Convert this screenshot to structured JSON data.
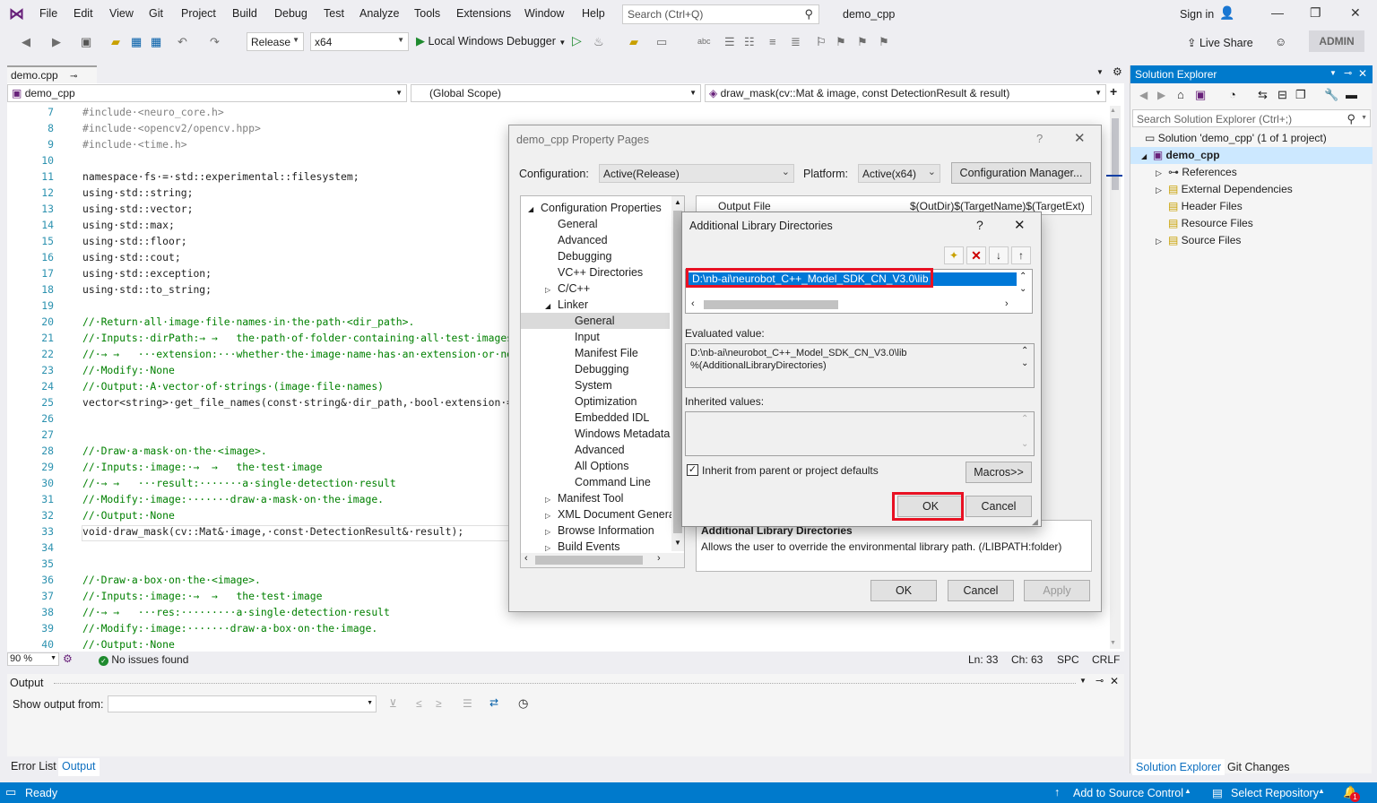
{
  "menu": {
    "items": [
      "File",
      "Edit",
      "View",
      "Git",
      "Project",
      "Build",
      "Debug",
      "Test",
      "Analyze",
      "Tools",
      "Extensions",
      "Window",
      "Help"
    ],
    "search_placeholder": "Search (Ctrl+Q)",
    "window_title": "demo_cpp",
    "sign_in": "Sign in"
  },
  "toolbar": {
    "configuration": "Release",
    "platform": "x64",
    "debugger": "Local Windows Debugger",
    "live_share": "Live Share",
    "admin": "ADMIN"
  },
  "editor": {
    "tab": "demo.cpp",
    "nav_file": "demo_cpp",
    "nav_scope": "(Global Scope)",
    "nav_member": "draw_mask(cv::Mat & image, const DetectionResult & result)",
    "zoom": "90 %",
    "issues": "No issues found",
    "ln": "Ln: 33",
    "ch": "Ch: 63",
    "spc": "SPC",
    "crlf": "CRLF"
  },
  "code": [
    {
      "n": "7",
      "t": "#include·<neuro_core.h>"
    },
    {
      "n": "8",
      "t": "#include·<opencv2/opencv.hpp>"
    },
    {
      "n": "9",
      "t": "#include·<time.h>"
    },
    {
      "n": "10",
      "t": ""
    },
    {
      "n": "11",
      "t": "namespace·fs·=·std::experimental::filesystem;"
    },
    {
      "n": "12",
      "t": "using·std::string;"
    },
    {
      "n": "13",
      "t": "using·std::vector;"
    },
    {
      "n": "14",
      "t": "using·std::max;"
    },
    {
      "n": "15",
      "t": "using·std::floor;"
    },
    {
      "n": "16",
      "t": "using·std::cout;"
    },
    {
      "n": "17",
      "t": "using·std::exception;"
    },
    {
      "n": "18",
      "t": "using·std::to_string;"
    },
    {
      "n": "19",
      "t": ""
    },
    {
      "n": "20",
      "t": "//·Return·all·image·file·names·in·the·path·<dir_path>."
    },
    {
      "n": "21",
      "t": "//·Inputs:·dirPath:→ →   the·path·of·folder·containing·all·test·images"
    },
    {
      "n": "22",
      "t": "//·→ →   ···extension:···whether·the·image·name·has·an·extension·or·not"
    },
    {
      "n": "23",
      "t": "//·Modify:·None"
    },
    {
      "n": "24",
      "t": "//·Output:·A·vector·of·strings·(image·file·names)"
    },
    {
      "n": "25",
      "t": "vector<string>·get_file_names(const·string&·dir_path,·bool·extension·="
    },
    {
      "n": "26",
      "t": ""
    },
    {
      "n": "27",
      "t": ""
    },
    {
      "n": "28",
      "t": "//·Draw·a·mask·on·the·<image>."
    },
    {
      "n": "29",
      "t": "//·Inputs:·image:·→  →   the·test·image"
    },
    {
      "n": "30",
      "t": "//·→ →   ···result:·······a·single·detection·result"
    },
    {
      "n": "31",
      "t": "//·Modify:·image:·······draw·a·mask·on·the·image."
    },
    {
      "n": "32",
      "t": "//·Output:·None"
    },
    {
      "n": "33",
      "t": "void·draw_mask(cv::Mat&·image,·const·DetectionResult&·result);"
    },
    {
      "n": "34",
      "t": ""
    },
    {
      "n": "35",
      "t": ""
    },
    {
      "n": "36",
      "t": "//·Draw·a·box·on·the·<image>."
    },
    {
      "n": "37",
      "t": "//·Inputs:·image:·→  →   the·test·image"
    },
    {
      "n": "38",
      "t": "//·→ →   ···res:·········a·single·detection·result"
    },
    {
      "n": "39",
      "t": "//·Modify:·image:·······draw·a·box·on·the·image."
    },
    {
      "n": "40",
      "t": "//·Output:·None"
    }
  ],
  "output": {
    "title": "Output",
    "show_from": "Show output from:"
  },
  "bottom_tabs": [
    "Error List",
    "Output"
  ],
  "status": {
    "ready": "Ready",
    "add_source": "Add to Source Control",
    "select_repo": "Select Repository",
    "notif": "1"
  },
  "solution_explorer": {
    "title": "Solution Explorer",
    "search_placeholder": "Search Solution Explorer (Ctrl+;)",
    "solution": "Solution 'demo_cpp' (1 of 1 project)",
    "project": "demo_cpp",
    "items": [
      "References",
      "External Dependencies",
      "Header Files",
      "Resource Files",
      "Source Files"
    ],
    "tabs": [
      "Solution Explorer",
      "Git Changes"
    ]
  },
  "property_pages": {
    "title": "demo_cpp Property Pages",
    "help": "?",
    "configuration_label": "Configuration:",
    "configuration_value": "Active(Release)",
    "platform_label": "Platform:",
    "platform_value": "Active(x64)",
    "config_manager": "Configuration Manager...",
    "tree": [
      {
        "label": "Configuration Properties",
        "level": 0,
        "exp": "◢"
      },
      {
        "label": "General",
        "level": 1,
        "exp": ""
      },
      {
        "label": "Advanced",
        "level": 1,
        "exp": ""
      },
      {
        "label": "Debugging",
        "level": 1,
        "exp": ""
      },
      {
        "label": "VC++ Directories",
        "level": 1,
        "exp": ""
      },
      {
        "label": "C/C++",
        "level": 1,
        "exp": "▷"
      },
      {
        "label": "Linker",
        "level": 1,
        "exp": "◢"
      },
      {
        "label": "General",
        "level": 2,
        "exp": "",
        "sel": true
      },
      {
        "label": "Input",
        "level": 2,
        "exp": ""
      },
      {
        "label": "Manifest File",
        "level": 2,
        "exp": ""
      },
      {
        "label": "Debugging",
        "level": 2,
        "exp": ""
      },
      {
        "label": "System",
        "level": 2,
        "exp": ""
      },
      {
        "label": "Optimization",
        "level": 2,
        "exp": ""
      },
      {
        "label": "Embedded IDL",
        "level": 2,
        "exp": ""
      },
      {
        "label": "Windows Metadata",
        "level": 2,
        "exp": ""
      },
      {
        "label": "Advanced",
        "level": 2,
        "exp": ""
      },
      {
        "label": "All Options",
        "level": 2,
        "exp": ""
      },
      {
        "label": "Command Line",
        "level": 2,
        "exp": ""
      },
      {
        "label": "Manifest Tool",
        "level": 1,
        "exp": "▷"
      },
      {
        "label": "XML Document Genera",
        "level": 1,
        "exp": "▷"
      },
      {
        "label": "Browse Information",
        "level": 1,
        "exp": "▷"
      },
      {
        "label": "Build Events",
        "level": 1,
        "exp": "▷"
      }
    ],
    "grid_prop": "Output File",
    "grid_value": "$(OutDir)$(TargetName)$(TargetExt)",
    "desc_title": "Additional Library Directories",
    "desc_text": "Allows the user to override the environmental library path. (/LIBPATH:folder)",
    "ok": "OK",
    "cancel": "Cancel",
    "apply": "Apply"
  },
  "lib_dialog": {
    "title": "Additional Library Directories",
    "help": "?",
    "entry": "D:\\nb-ai\\neurobot_C++_Model_SDK_CN_V3.0\\lib",
    "evaluated_label": "Evaluated value:",
    "evaluated_line1": "D:\\nb-ai\\neurobot_C++_Model_SDK_CN_V3.0\\lib",
    "evaluated_line2": "%(AdditionalLibraryDirectories)",
    "inherited_label": "Inherited values:",
    "inherit_checkbox": "Inherit from parent or project defaults",
    "macros": "Macros>>",
    "ok": "OK",
    "cancel": "Cancel"
  }
}
